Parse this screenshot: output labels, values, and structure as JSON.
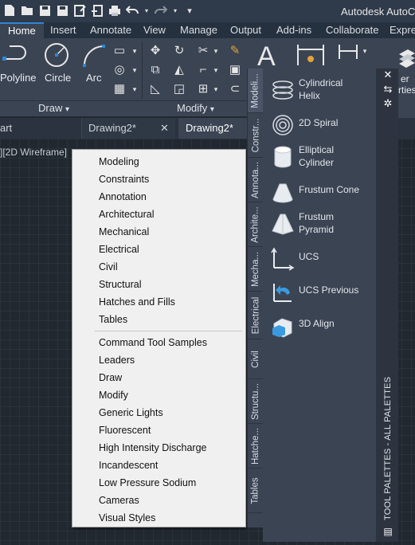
{
  "window": {
    "title": "Autodesk AutoCA"
  },
  "ribbon_tabs": [
    {
      "label": "Home",
      "active": true
    },
    {
      "label": "Insert"
    },
    {
      "label": "Annotate"
    },
    {
      "label": "View"
    },
    {
      "label": "Manage"
    },
    {
      "label": "Output"
    },
    {
      "label": "Add-ins"
    },
    {
      "label": "Collaborate"
    },
    {
      "label": "Expres"
    }
  ],
  "ribbon": {
    "draw_buttons": [
      "Polyline",
      "Circle",
      "Arc"
    ],
    "panel_draw": "Draw",
    "panel_modify": "Modify",
    "right_partial_1": "er",
    "right_partial_2": "rties"
  },
  "doc_tabs": [
    "art",
    "Drawing2*",
    "Drawing2*"
  ],
  "viewport_label": "][2D Wireframe]",
  "context_menu": {
    "group1": [
      "Modeling",
      "Constraints",
      "Annotation",
      "Architectural",
      "Mechanical",
      "Electrical",
      "Civil",
      "Structural",
      "Hatches and Fills",
      "Tables"
    ],
    "group2": [
      "Command Tool Samples",
      "Leaders",
      "Draw",
      "Modify",
      "Generic Lights",
      "Fluorescent",
      "High Intensity Discharge",
      "Incandescent",
      "Low Pressure Sodium",
      "Cameras",
      "Visual Styles"
    ]
  },
  "palette_tabs": [
    "Modeli...",
    "Constr...",
    "Annota...",
    "Archite...",
    "Mecha...",
    "Electrical",
    "Civil",
    "Structu...",
    "Hatche...",
    "Tables"
  ],
  "palette_items": [
    {
      "label_line1": "Cylindrical",
      "label_line2": "Helix",
      "icon": "helix-icon"
    },
    {
      "label_line1": "2D Spiral",
      "label_line2": "",
      "icon": "spiral-icon"
    },
    {
      "label_line1": "Elliptical",
      "label_line2": "Cylinder",
      "icon": "cylinder-icon"
    },
    {
      "label_line1": "Frustum Cone",
      "label_line2": "",
      "icon": "cone-icon"
    },
    {
      "label_line1": "Frustum",
      "label_line2": "Pyramid",
      "icon": "pyramid-icon"
    },
    {
      "label_line1": "UCS",
      "label_line2": "",
      "icon": "ucs-icon"
    },
    {
      "label_line1": "UCS Previous",
      "label_line2": "",
      "icon": "ucs-previous-icon"
    },
    {
      "label_line1": "3D Align",
      "label_line2": "",
      "icon": "3d-align-icon"
    }
  ],
  "palette_title": "TOOL PALETTES - ALL PALETTES",
  "colors": {
    "accent": "#2f86d6",
    "ribbon": "#3b4453",
    "menu_bg": "#f0f0f0"
  }
}
